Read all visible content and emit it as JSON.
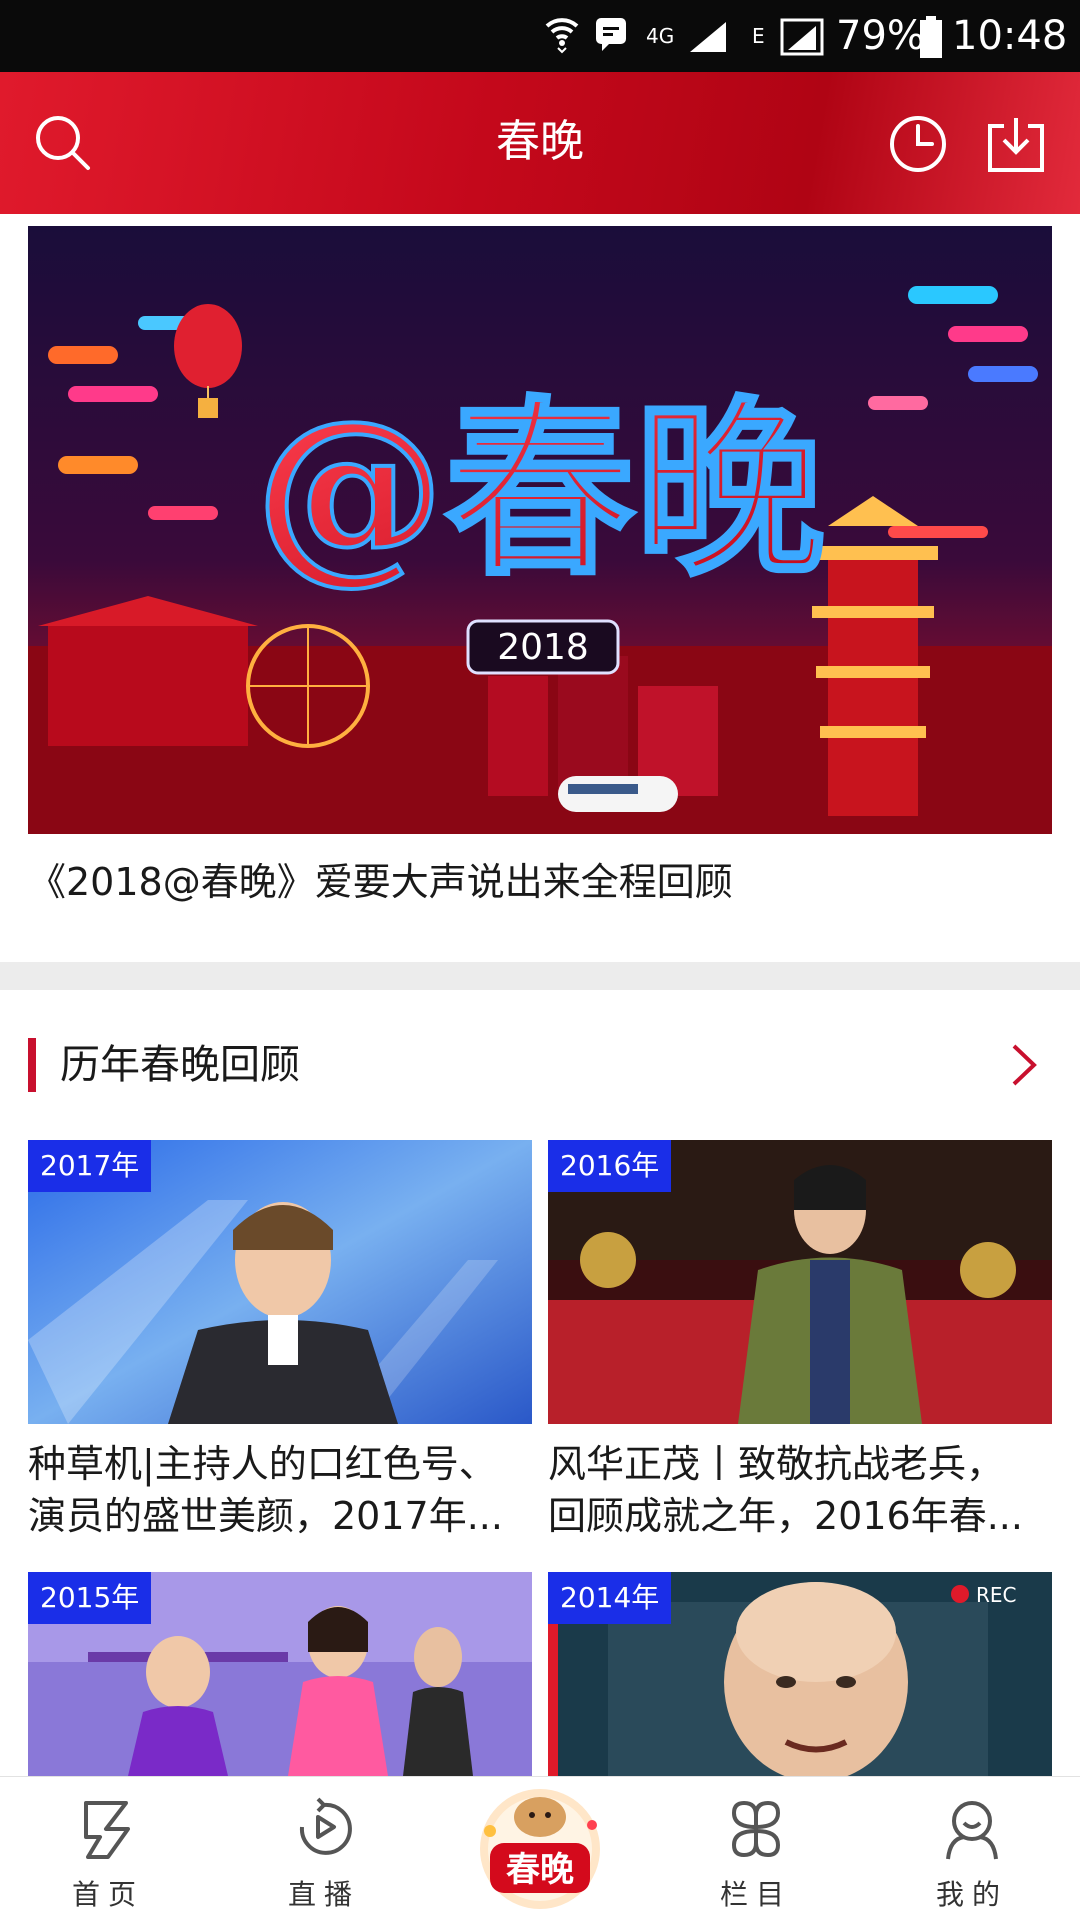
{
  "status_bar": {
    "network_4g": "4G",
    "network_e": "E",
    "battery": "79%",
    "time": "10:48"
  },
  "header": {
    "title": "春晚",
    "icons": [
      "search-icon",
      "history-clock-icon",
      "download-icon"
    ]
  },
  "hero": {
    "image_title": "@春晚",
    "image_year": "2018",
    "caption": "《2018@春晚》爱要大声说出来全程回顾"
  },
  "section": {
    "title": "历年春晚回顾",
    "more_icon": "chevron-right-icon"
  },
  "cards": [
    {
      "year": "2017年",
      "line1": "种草机|主持人的口红色号、",
      "line2": "演员的盛世美颜，2017年..."
    },
    {
      "year": "2016年",
      "line1": "风华正茂丨致敬抗战老兵，",
      "line2": "回顾成就之年，2016年春..."
    },
    {
      "year": "2015年",
      "line1": "",
      "line2": ""
    },
    {
      "year": "2014年",
      "rec": "REC",
      "line1": "",
      "line2": ""
    }
  ],
  "bottom_nav": [
    {
      "label": "首页",
      "icon": "home-icon"
    },
    {
      "label": "直播",
      "icon": "live-play-icon"
    },
    {
      "label": "春晚",
      "icon": "spring-gala-logo"
    },
    {
      "label": "栏目",
      "icon": "columns-icon"
    },
    {
      "label": "我的",
      "icon": "profile-icon"
    }
  ],
  "colors": {
    "header_red": "#c4081b",
    "accent_red": "#c8102e",
    "badge_blue": "#1a2ee8"
  }
}
